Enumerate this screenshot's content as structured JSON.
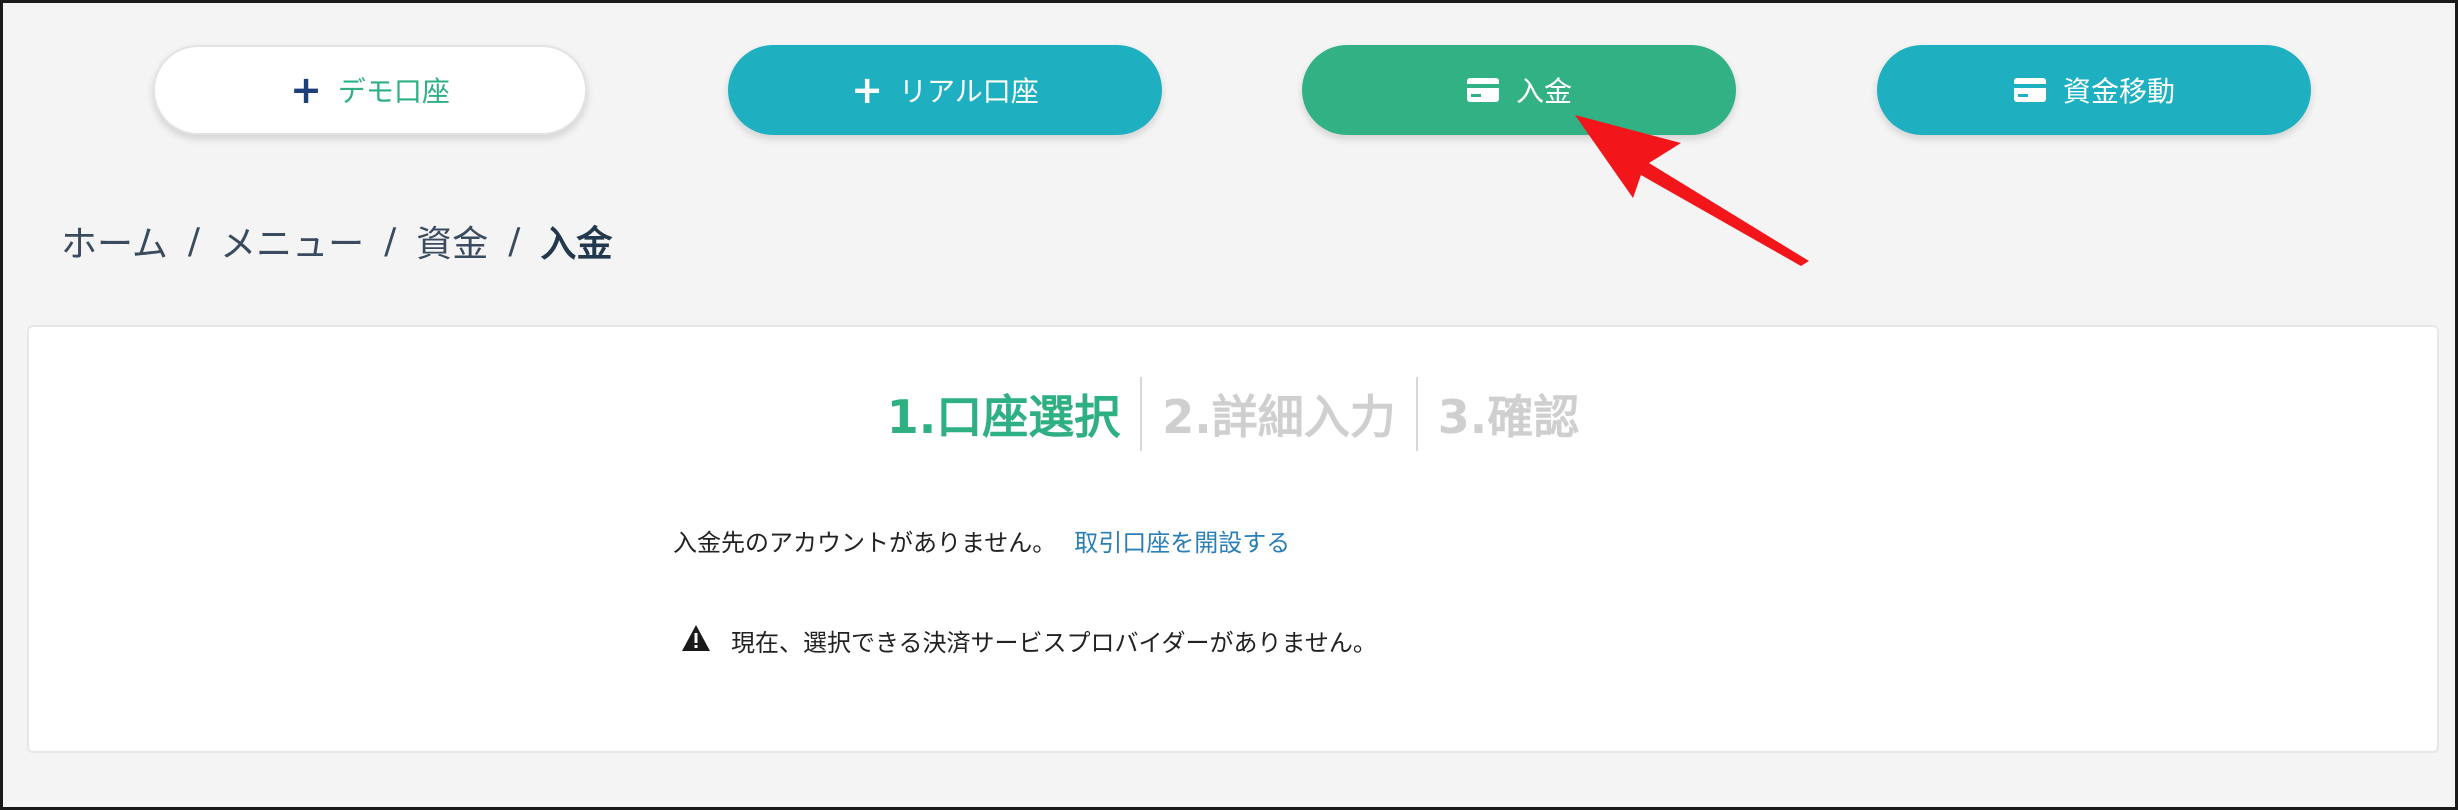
{
  "top_buttons": {
    "demo_label": "デモ口座",
    "real_label": "リアル口座",
    "deposit_label": "入金",
    "transfer_label": "資金移動"
  },
  "breadcrumb": {
    "items": [
      "ホーム",
      "メニュー",
      "資金"
    ],
    "current": "入金",
    "separator": "/"
  },
  "steps": [
    {
      "label": "1.口座選択",
      "state": "active"
    },
    {
      "label": "2.詳細入力",
      "state": "inactive"
    },
    {
      "label": "3.確認",
      "state": "inactive"
    }
  ],
  "message": {
    "text": "入金先のアカウントがありません。",
    "link": "取引口座を開設する"
  },
  "warning": {
    "text": "現在、選択できる決済サービスプロバイダーがありません。",
    "icon": "warning-icon"
  },
  "colors": {
    "green": "#31b184",
    "teal": "#1eb0c0",
    "arrow_red": "#f2161b"
  }
}
